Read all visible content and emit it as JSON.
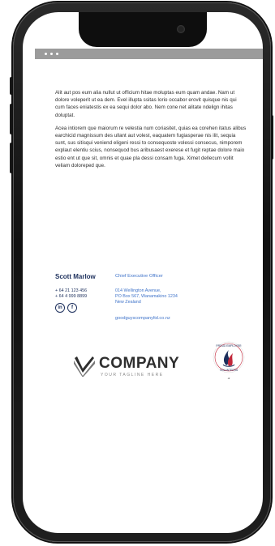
{
  "browser": {
    "menu_dots": "•••"
  },
  "body": {
    "paragraphs": [
      "Alit aut pos eum alia nullut ut officium hitae moluptas eum quam andae. Nam ut dolore voleperit ut ea dem. Evel illupta ssitas lorio occabor erovit quisque nis qui cum faces eniatestis ex ea sequi dolor abo. Nem cone net alitate ndelign ihitas doluptat.",
      "Acea intiorem que maiorum re velestia num coriasitet, quias ea corehen itatus alibus earchicid magnissum des ullant aut volest, eaquatem fugiasperae nis ilit, sequia sunt, sus sitisqui veniend eligeni ressi to consequoste volessi consecus, nimporem explaut elentiu scius, nonsequod bus aribusaest exerese et fugit reptae dolore maio estio ent ut que sit, omnis et quae pla dessi consam fuga. Ximet dellecum vollit veliam doloreped que."
    ]
  },
  "signature": {
    "name": "Scott Marlow",
    "title": "Chief Executive Officer",
    "phones": [
      "+ 64 21 123 456",
      "+ 64 4 999 8899"
    ],
    "address": [
      "014 Wellington Avenue,",
      "PO Box 567, Wanamakino 1234",
      "New Zealand"
    ],
    "website": "goodguyscompanyltd.co.nz",
    "social": [
      {
        "icon": "linkedin-icon",
        "label": "in"
      },
      {
        "icon": "facebook-icon",
        "label": "f"
      }
    ]
  },
  "logos": {
    "company_name": "COMPANY",
    "company_tagline": "YOUR TAGLINE HERE",
    "badge_text_top": "PROUD EMPLOYER",
    "badge_text_bottom": "VOLUNTEERS",
    "badge_text_foot": "of"
  },
  "colors": {
    "browser_bar": "#9b9b9b",
    "name": "#1c2f5c",
    "details": "#3f73c9",
    "company": "#2e2e2e"
  }
}
